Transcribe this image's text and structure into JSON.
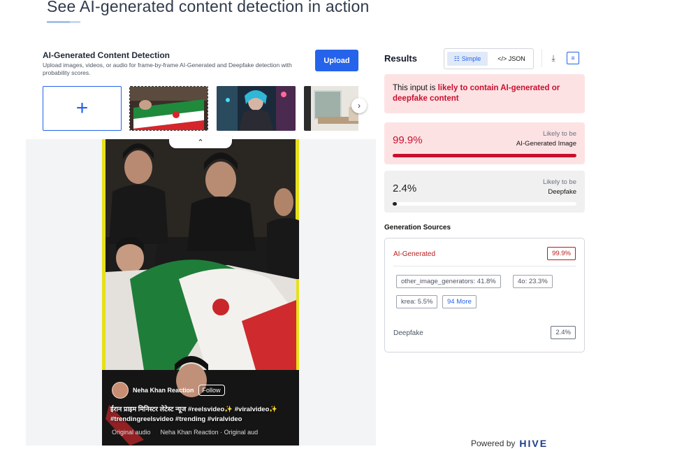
{
  "header": {
    "title": "See AI-generated content detection in action"
  },
  "detector": {
    "title": "AI-Generated Content Detection",
    "description": "Upload images, videos, or audio for frame-by-frame AI-Generated and Deepfake detection with probability scores.",
    "upload_label": "Upload",
    "add_icon": "plus-icon"
  },
  "preview": {
    "channel_name": "Neha Khan Reaction",
    "follow_label": "Follow",
    "caption": "ईरान प्राइम मिनिस्टर लेटेस्ट न्यूज #reelsvideo✨ #viralvideo✨ #trendingreelsvideo #trending #viralvideo",
    "audio_left": "Original audio",
    "audio_right": "Neha Khan Reaction · Original aud"
  },
  "results": {
    "title": "Results",
    "view_simple": "Simple",
    "view_json": "</> JSON",
    "verdict_prefix": "This input is ",
    "verdict_highlight": "likely to contain AI-generated or deepfake content",
    "ai": {
      "pct": "99.9%",
      "value": 0.999,
      "label_top": "Likely to be",
      "label_bottom": "AI-Generated Image"
    },
    "deepfake": {
      "pct": "2.4%",
      "value": 0.024,
      "label_top": "Likely to be",
      "label_bottom": "Deepfake"
    }
  },
  "sources": {
    "title": "Generation Sources",
    "ai_label": "AI-Generated",
    "ai_pct": "99.9%",
    "chips": [
      "other_image_generators: 41.8%",
      "4o: 23.3%",
      "krea: 5.5%"
    ],
    "more": "94 More",
    "deepfake_label": "Deepfake",
    "deepfake_pct": "2.4%"
  },
  "footer": {
    "powered_by": "Powered by",
    "brand": "HIVE"
  },
  "colors": {
    "accent": "#2563eb",
    "danger": "#c8102e"
  }
}
